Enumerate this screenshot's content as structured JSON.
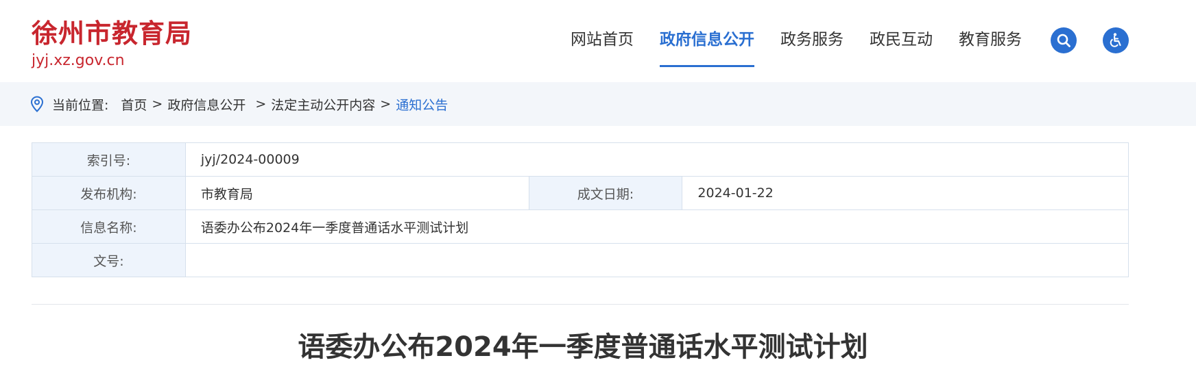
{
  "header": {
    "logo_title": "徐州市教育局",
    "logo_domain": "jyj.xz.gov.cn",
    "nav": [
      {
        "label": "网站首页"
      },
      {
        "label": "政府信息公开"
      },
      {
        "label": "政务服务"
      },
      {
        "label": "政民互动"
      },
      {
        "label": "教育服务"
      }
    ],
    "active_nav": "政府信息公开",
    "search_icon": "search-icon",
    "accessibility_icon": "wheelchair-icon"
  },
  "breadcrumb": {
    "label": "当前位置:",
    "items": [
      "首页",
      "政府信息公开",
      "法定主动公开内容"
    ],
    "current": "通知公告",
    "separator": ">"
  },
  "meta": {
    "index_label": "索引号:",
    "index_value": "jyj/2024-00009",
    "publisher_label": "发布机构:",
    "publisher_value": "市教育局",
    "date_label": "成文日期:",
    "date_value": "2024-01-22",
    "name_label": "信息名称:",
    "name_value": "语委办公布2024年一季度普通话水平测试计划",
    "doc_no_label": "文号:",
    "doc_no_value": ""
  },
  "article": {
    "title": "语委办公布2024年一季度普通话水平测试计划"
  },
  "colors": {
    "brand_red": "#c8262e",
    "accent_blue": "#2a6fd1",
    "breadcrumb_bg": "#f3f6fa",
    "label_cell_bg": "#eef4fc"
  }
}
